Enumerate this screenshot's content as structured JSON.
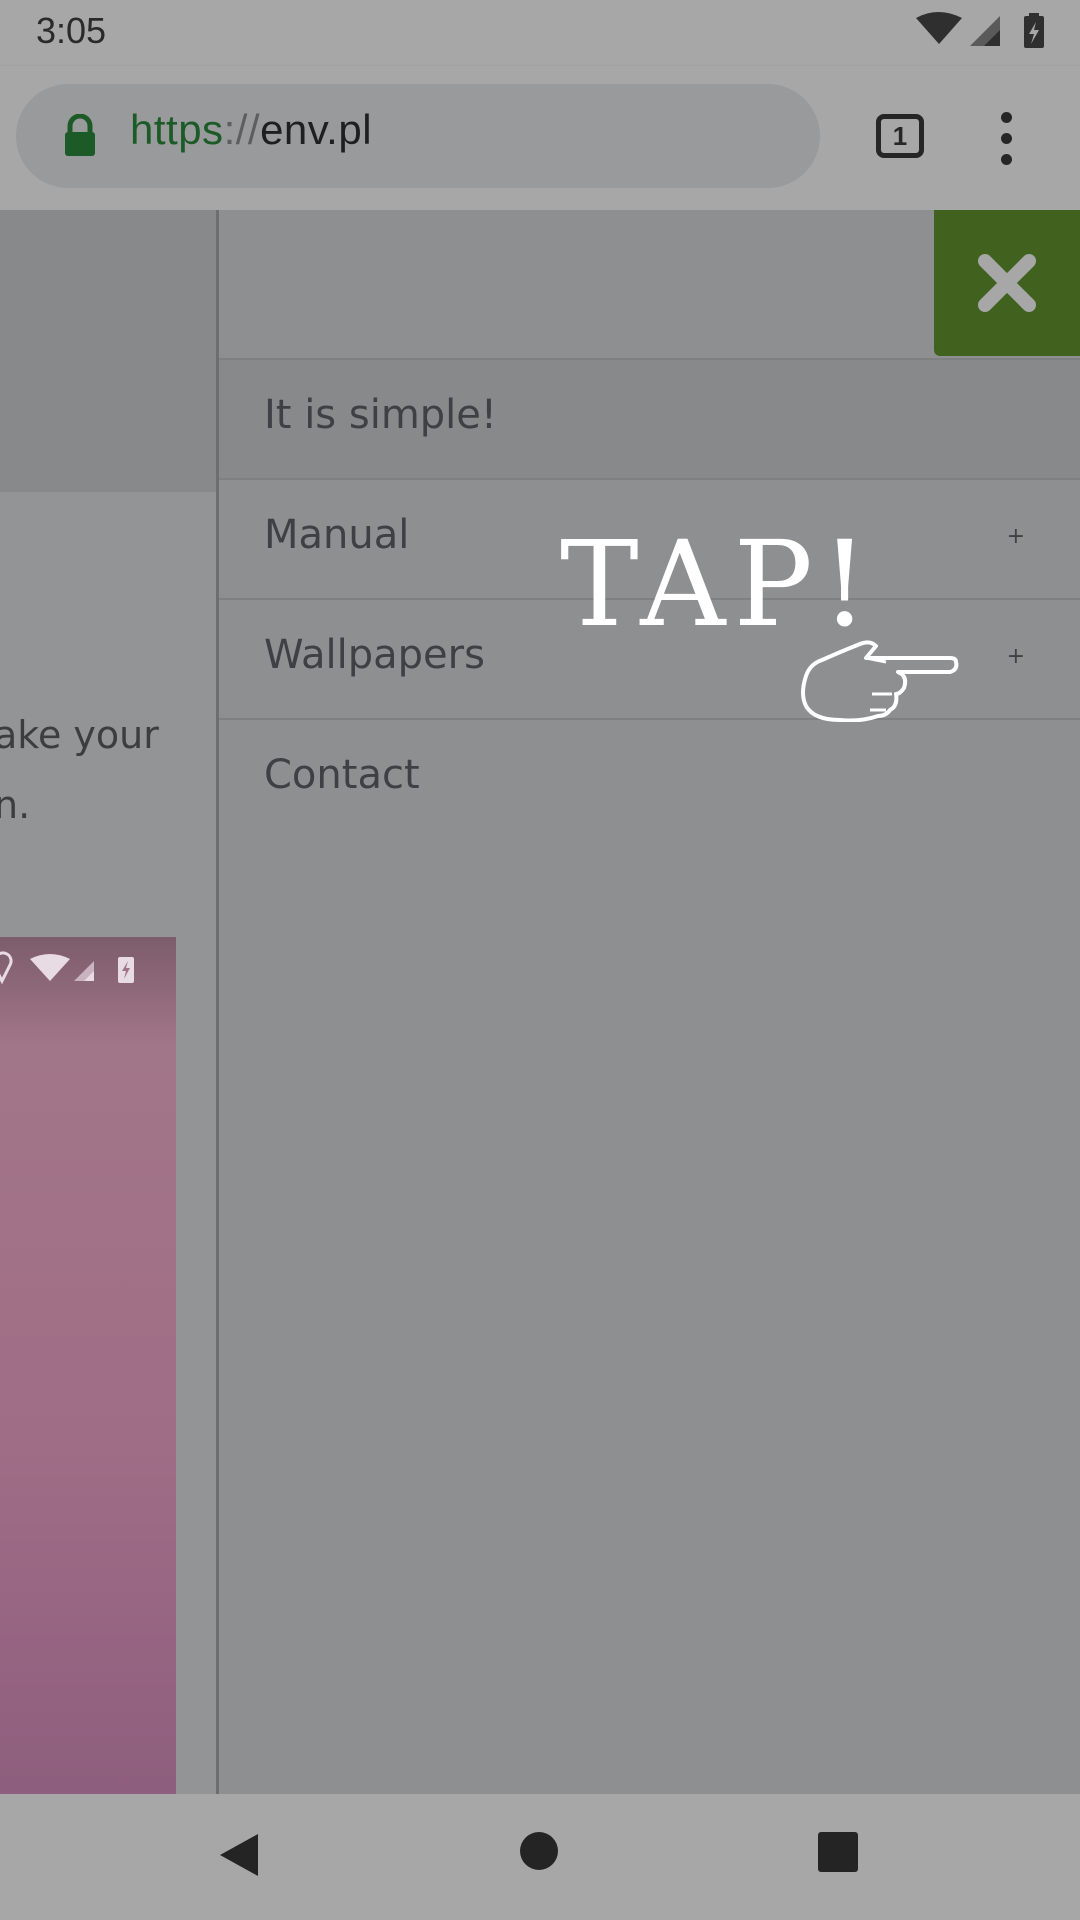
{
  "status_bar": {
    "time": "3:05"
  },
  "browser": {
    "url_scheme": "https",
    "url_separator": "://",
    "url_host": "env.pl",
    "tab_count": "1"
  },
  "page_behind": {
    "text_line1": "ake your",
    "text_line2": "n."
  },
  "drawer": {
    "items": [
      {
        "label": "It is simple!",
        "expand": ""
      },
      {
        "label": "Manual",
        "expand": "+"
      },
      {
        "label": "Wallpapers",
        "expand": "+"
      },
      {
        "label": "Contact",
        "expand": ""
      }
    ]
  },
  "overlay": {
    "tap_text": "TAP!"
  },
  "colors": {
    "close_button": "#41621f",
    "secure_scheme": "#1c5a27"
  }
}
